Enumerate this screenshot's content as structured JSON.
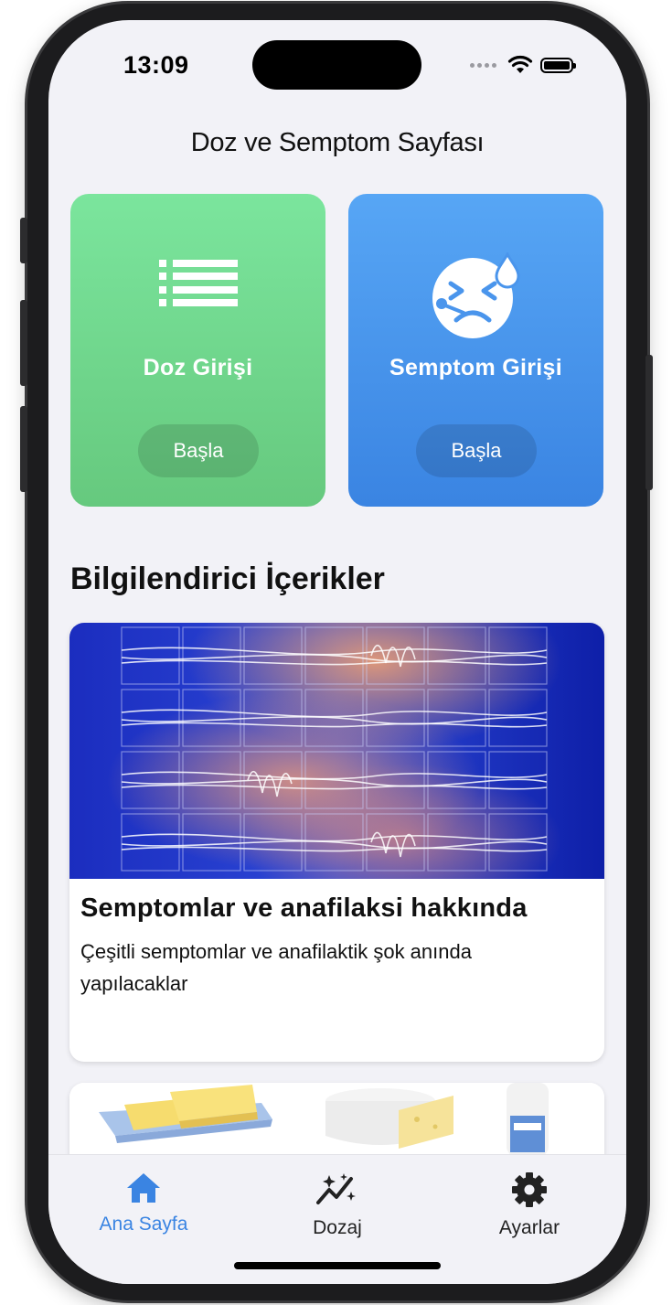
{
  "status_bar": {
    "time": "13:09"
  },
  "page_title": "Doz ve Semptom Sayfası",
  "entry_cards": [
    {
      "label": "Doz Girişi",
      "button": "Başla",
      "icon": "list-icon",
      "color": "#6fd68c"
    },
    {
      "label": "Semptom Girişi",
      "button": "Başla",
      "icon": "sick-face-icon",
      "color": "#4a95ec"
    }
  ],
  "section_title": "Bilgilendirici İçerikler",
  "info_cards": [
    {
      "title": "Semptomlar ve anafilaksi hakkında",
      "description": "Çeşitli semptomlar ve anafilaktik şok anında yapılacaklar",
      "image": "waveform-grid-image"
    },
    {
      "image": "dairy-products-image"
    }
  ],
  "tabbar": {
    "tabs": [
      {
        "label": "Ana Sayfa",
        "icon": "home-icon",
        "active": true
      },
      {
        "label": "Dozaj",
        "icon": "chart-sparkle-icon",
        "active": false
      },
      {
        "label": "Ayarlar",
        "icon": "gear-icon",
        "active": false
      }
    ],
    "active_color": "#3a84e2"
  }
}
